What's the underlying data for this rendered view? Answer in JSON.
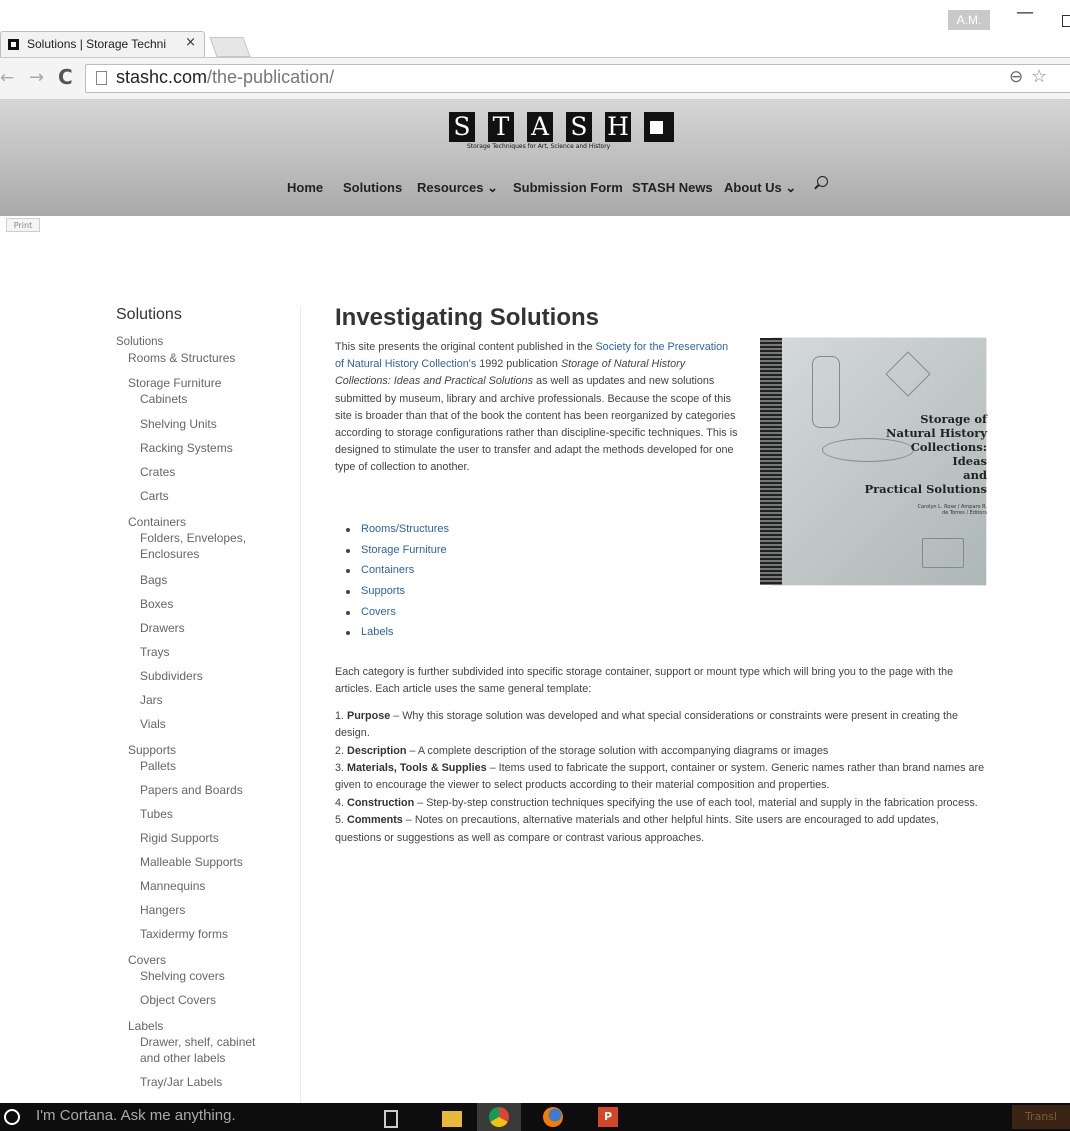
{
  "browser": {
    "tab_title": "Solutions | Storage Techni",
    "tab_close": "×",
    "user_badge": "A.M.",
    "url_host": "stashc.com",
    "url_path": "/the-publication/"
  },
  "site": {
    "logo_letters": [
      "S",
      "T",
      "A",
      "S",
      "H"
    ],
    "tagline": "Storage Techniques for Art, Science and History",
    "nav": [
      {
        "label": "Home"
      },
      {
        "label": "Solutions"
      },
      {
        "label": "Resources ⌄"
      },
      {
        "label": "Submission Form"
      },
      {
        "label": "STASH News"
      },
      {
        "label": "About Us ⌄"
      }
    ],
    "print_label": "Print"
  },
  "sidebar": {
    "title": "Solutions",
    "items": [
      {
        "label": "Solutions",
        "level": 0
      },
      {
        "label": "Rooms & Structures",
        "level": 1
      },
      {
        "label": "Storage Furniture",
        "level": 1
      },
      {
        "label": "Cabinets",
        "level": 2
      },
      {
        "label": "Shelving Units",
        "level": 2
      },
      {
        "label": "Racking Systems",
        "level": 2
      },
      {
        "label": "Crates",
        "level": 2
      },
      {
        "label": "Carts",
        "level": 2
      },
      {
        "label": "Containers",
        "level": 1
      },
      {
        "label": "Folders, Envelopes,",
        "level": 2
      },
      {
        "label": "Enclosures",
        "level": 2
      },
      {
        "label": "Bags",
        "level": 2
      },
      {
        "label": "Boxes",
        "level": 2
      },
      {
        "label": "Drawers",
        "level": 2
      },
      {
        "label": "Trays",
        "level": 2
      },
      {
        "label": "Subdividers",
        "level": 2
      },
      {
        "label": "Jars",
        "level": 2
      },
      {
        "label": "Vials",
        "level": 2
      },
      {
        "label": "Supports",
        "level": 1
      },
      {
        "label": "Pallets",
        "level": 2
      },
      {
        "label": "Papers and Boards",
        "level": 2
      },
      {
        "label": "Tubes",
        "level": 2
      },
      {
        "label": "Rigid Supports",
        "level": 2
      },
      {
        "label": "Malleable Supports",
        "level": 2
      },
      {
        "label": "Mannequins",
        "level": 2
      },
      {
        "label": "Hangers",
        "level": 2
      },
      {
        "label": "Taxidermy forms",
        "level": 2
      },
      {
        "label": "Covers",
        "level": 1
      },
      {
        "label": "Shelving covers",
        "level": 2
      },
      {
        "label": "Object Covers",
        "level": 2
      },
      {
        "label": "Labels",
        "level": 1
      },
      {
        "label": "Drawer, shelf, cabinet",
        "level": 2
      },
      {
        "label": "and other labels",
        "level": 2
      },
      {
        "label": "Tray/Jar Labels",
        "level": 2
      }
    ]
  },
  "main": {
    "title": "Investigating Solutions",
    "intro": {
      "p1": "This site presents the original content published in the ",
      "link1": "Society for the Preservation of Natural History Collection's",
      "p2": " 1992 publication ",
      "book_italic": "Storage of Natural History Collections: Ideas and Practical Solutions",
      "p3": " as well as updates and new solutions submitted by museum, library and archive professionals. Because the scope of this site is broader than that of the book the content has been reorganized by categories according to storage configurations rather than discipline-specific techniques. This is designed to stimulate the user to transfer and adapt the methods developed for one type of collection to another."
    },
    "categories": [
      "Rooms/Structures",
      "Storage Furniture",
      "Containers",
      "Supports",
      "Covers",
      "Labels"
    ],
    "subdivided_text": "Each category is further subdivided into specific storage container, support or mount type which will bring you to the page with the articles.  Each article uses the same general template:",
    "template_items": [
      {
        "num": "1. ",
        "term": "Purpose",
        "desc": " – Why this storage solution was developed and what special considerations or constraints were present in creating the design."
      },
      {
        "num": "2. ",
        "term": "Description",
        "desc": " – A complete description of the storage solution with accompanying diagrams or images"
      },
      {
        "num": "3. ",
        "term": "Materials, Tools & Supplies",
        "desc": " – Items used to fabricate the support, container or system. Generic names rather than brand names are given to encourage the viewer to select products according to their material composition and properties."
      },
      {
        "num": "4. ",
        "term": "Construction",
        "desc": " – Step-by-step construction techniques specifying the use of each tool, material and supply in the fabrication process."
      },
      {
        "num": "5. ",
        "term": "Comments",
        "desc": " – Notes on precautions, alternative materials and other helpful hints. Site users are encouraged to add updates, questions or suggestions as well as compare or contrast various approaches."
      }
    ],
    "book": {
      "title_lines": [
        "Storage of",
        "Natural History",
        "Collections:",
        "Ideas",
        "and",
        "Practical Solutions"
      ],
      "editors": "Carolyn L. Rose / Amparo R. de Torres / Editors"
    }
  },
  "taskbar": {
    "cortana_text": "I'm Cortana. Ask me anything.",
    "ppt_label": "P",
    "translate_label": "Transl"
  },
  "colors": {
    "link": "#2d63a8",
    "header_gradient_top": "#d6d6d6",
    "header_gradient_bottom": "#a9a9a9",
    "taskbar": "#0d0d0d"
  }
}
